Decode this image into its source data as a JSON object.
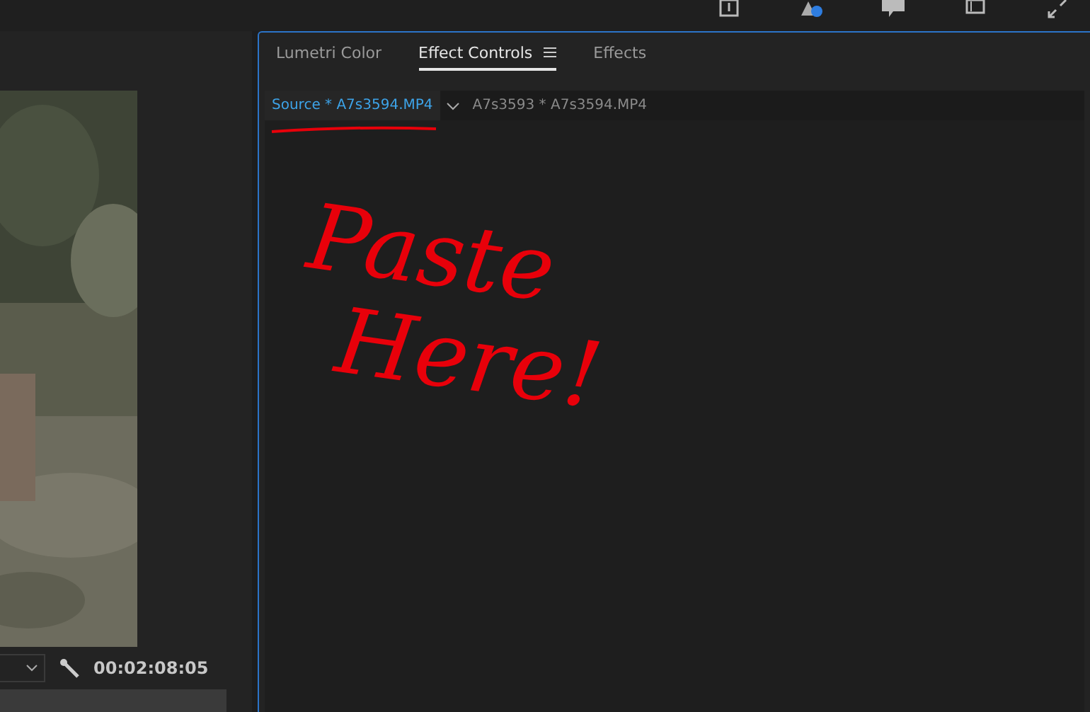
{
  "monitor": {
    "timecode": "00:02:08:05"
  },
  "panel": {
    "tabs": [
      {
        "label": "Lumetri Color",
        "selected": false
      },
      {
        "label": "Effect Controls",
        "selected": true
      },
      {
        "label": "Effects",
        "selected": false
      }
    ],
    "clip_tabs": [
      {
        "label": "Source * A7s3594.MP4",
        "selected": true
      },
      {
        "label": "A7s3593 * A7s3594.MP4",
        "selected": false
      }
    ]
  },
  "annotation": {
    "lines": [
      "Paste",
      "Here!"
    ]
  }
}
